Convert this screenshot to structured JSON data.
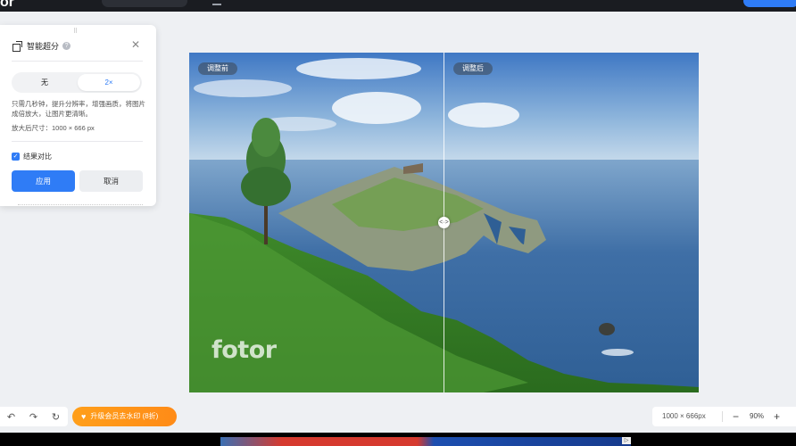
{
  "topbar": {
    "logo_fragment": "or"
  },
  "panel": {
    "title": "智能超分",
    "help_glyph": "?",
    "close_glyph": "✕",
    "grip_glyph": "⠿",
    "scale_options": [
      "无",
      "2×"
    ],
    "selected_option": "2×",
    "description": "只需几秒钟，提升分辨率，增强画质，将图片成倍放大，让图片更清晰。",
    "output_size": "放大后尺寸：1000 × 666 px",
    "compare_label": "结果对比",
    "compare_checked": true,
    "apply_label": "应用",
    "cancel_label": "取消"
  },
  "image": {
    "before_label": "调整前",
    "after_label": "调整后",
    "handle_glyph": "<·>",
    "watermark": "fotor",
    "split_fraction": 0.5
  },
  "bottombar": {
    "undo_glyph": "↶",
    "redo_glyph": "↷",
    "reset_glyph": "↻",
    "upgrade_icon": "♥",
    "upgrade_label": "升级会员去水印 (8折)",
    "image_dims": "1000 × 666px",
    "zoom_minus": "−",
    "zoom_level": "90%",
    "zoom_plus": "+"
  },
  "colors": {
    "accent": "#2f7cf6",
    "upgrade": "#ff9a1a",
    "topbar": "#1a1c21"
  }
}
